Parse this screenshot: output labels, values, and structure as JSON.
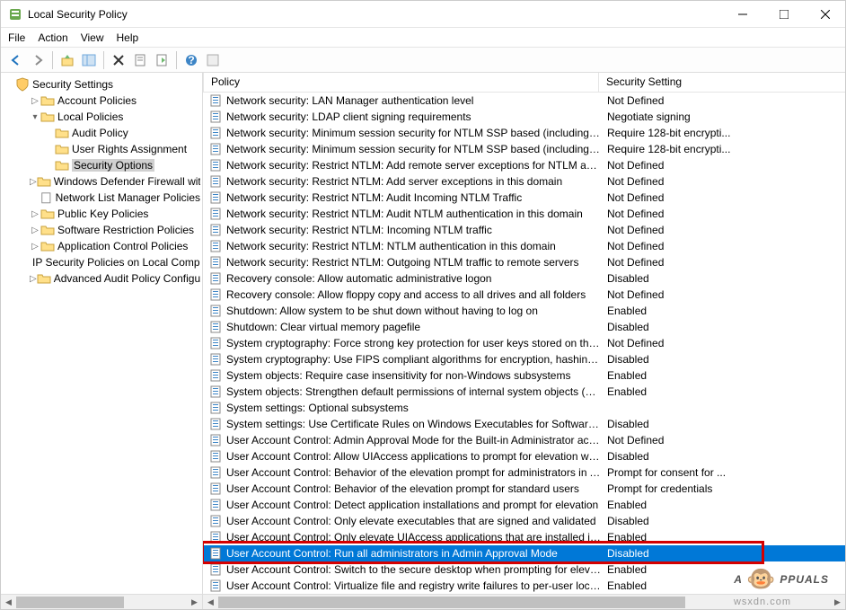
{
  "window": {
    "title": "Local Security Policy"
  },
  "menu": {
    "file": "File",
    "action": "Action",
    "view": "View",
    "help": "Help"
  },
  "tree": {
    "root": "Security Settings",
    "account_policies": "Account Policies",
    "local_policies": "Local Policies",
    "audit_policy": "Audit Policy",
    "user_rights": "User Rights Assignment",
    "security_options": "Security Options",
    "windows_firewall": "Windows Defender Firewall with Advanced Security",
    "network_list": "Network List Manager Policies",
    "public_key": "Public Key Policies",
    "software_restriction": "Software Restriction Policies",
    "app_control": "Application Control Policies",
    "ip_security": "IP Security Policies on Local Computer",
    "advanced_audit": "Advanced Audit Policy Configuration"
  },
  "columns": {
    "policy": "Policy",
    "setting": "Security Setting"
  },
  "policies": [
    {
      "name": "Network security: LAN Manager authentication level",
      "setting": "Not Defined"
    },
    {
      "name": "Network security: LDAP client signing requirements",
      "setting": "Negotiate signing"
    },
    {
      "name": "Network security: Minimum session security for NTLM SSP based (including secure R...",
      "setting": "Require 128-bit encrypti..."
    },
    {
      "name": "Network security: Minimum session security for NTLM SSP based (including secure R...",
      "setting": "Require 128-bit encrypti..."
    },
    {
      "name": "Network security: Restrict NTLM: Add remote server exceptions for NTLM authenticati...",
      "setting": "Not Defined"
    },
    {
      "name": "Network security: Restrict NTLM: Add server exceptions in this domain",
      "setting": "Not Defined"
    },
    {
      "name": "Network security: Restrict NTLM: Audit Incoming NTLM Traffic",
      "setting": "Not Defined"
    },
    {
      "name": "Network security: Restrict NTLM: Audit NTLM authentication in this domain",
      "setting": "Not Defined"
    },
    {
      "name": "Network security: Restrict NTLM: Incoming NTLM traffic",
      "setting": "Not Defined"
    },
    {
      "name": "Network security: Restrict NTLM: NTLM authentication in this domain",
      "setting": "Not Defined"
    },
    {
      "name": "Network security: Restrict NTLM: Outgoing NTLM traffic to remote servers",
      "setting": "Not Defined"
    },
    {
      "name": "Recovery console: Allow automatic administrative logon",
      "setting": "Disabled"
    },
    {
      "name": "Recovery console: Allow floppy copy and access to all drives and all folders",
      "setting": "Not Defined"
    },
    {
      "name": "Shutdown: Allow system to be shut down without having to log on",
      "setting": "Enabled"
    },
    {
      "name": "Shutdown: Clear virtual memory pagefile",
      "setting": "Disabled"
    },
    {
      "name": "System cryptography: Force strong key protection for user keys stored on the computer",
      "setting": "Not Defined"
    },
    {
      "name": "System cryptography: Use FIPS compliant algorithms for encryption, hashing, and sig...",
      "setting": "Disabled"
    },
    {
      "name": "System objects: Require case insensitivity for non-Windows subsystems",
      "setting": "Enabled"
    },
    {
      "name": "System objects: Strengthen default permissions of internal system objects (e.g. Symb...",
      "setting": "Enabled"
    },
    {
      "name": "System settings: Optional subsystems",
      "setting": ""
    },
    {
      "name": "System settings: Use Certificate Rules on Windows Executables for Software Restrictio...",
      "setting": "Disabled"
    },
    {
      "name": "User Account Control: Admin Approval Mode for the Built-in Administrator account",
      "setting": "Not Defined"
    },
    {
      "name": "User Account Control: Allow UIAccess applications to prompt for elevation without u...",
      "setting": "Disabled"
    },
    {
      "name": "User Account Control: Behavior of the elevation prompt for administrators in Admin ...",
      "setting": "Prompt for consent for ..."
    },
    {
      "name": "User Account Control: Behavior of the elevation prompt for standard users",
      "setting": "Prompt for credentials"
    },
    {
      "name": "User Account Control: Detect application installations and prompt for elevation",
      "setting": "Enabled"
    },
    {
      "name": "User Account Control: Only elevate executables that are signed and validated",
      "setting": "Disabled"
    },
    {
      "name": "User Account Control: Only elevate UIAccess applications that are installed in secure l...",
      "setting": "Enabled"
    },
    {
      "name": "User Account Control: Run all administrators in Admin Approval Mode",
      "setting": "Disabled",
      "selected": true
    },
    {
      "name": "User Account Control: Switch to the secure desktop when prompting for elevation",
      "setting": "Enabled"
    },
    {
      "name": "User Account Control: Virtualize file and registry write failures to per-user locations",
      "setting": "Enabled"
    }
  ],
  "watermark": {
    "text_left": "A",
    "text_right": "PPUALS"
  },
  "url_watermark": "wsxdn.com"
}
